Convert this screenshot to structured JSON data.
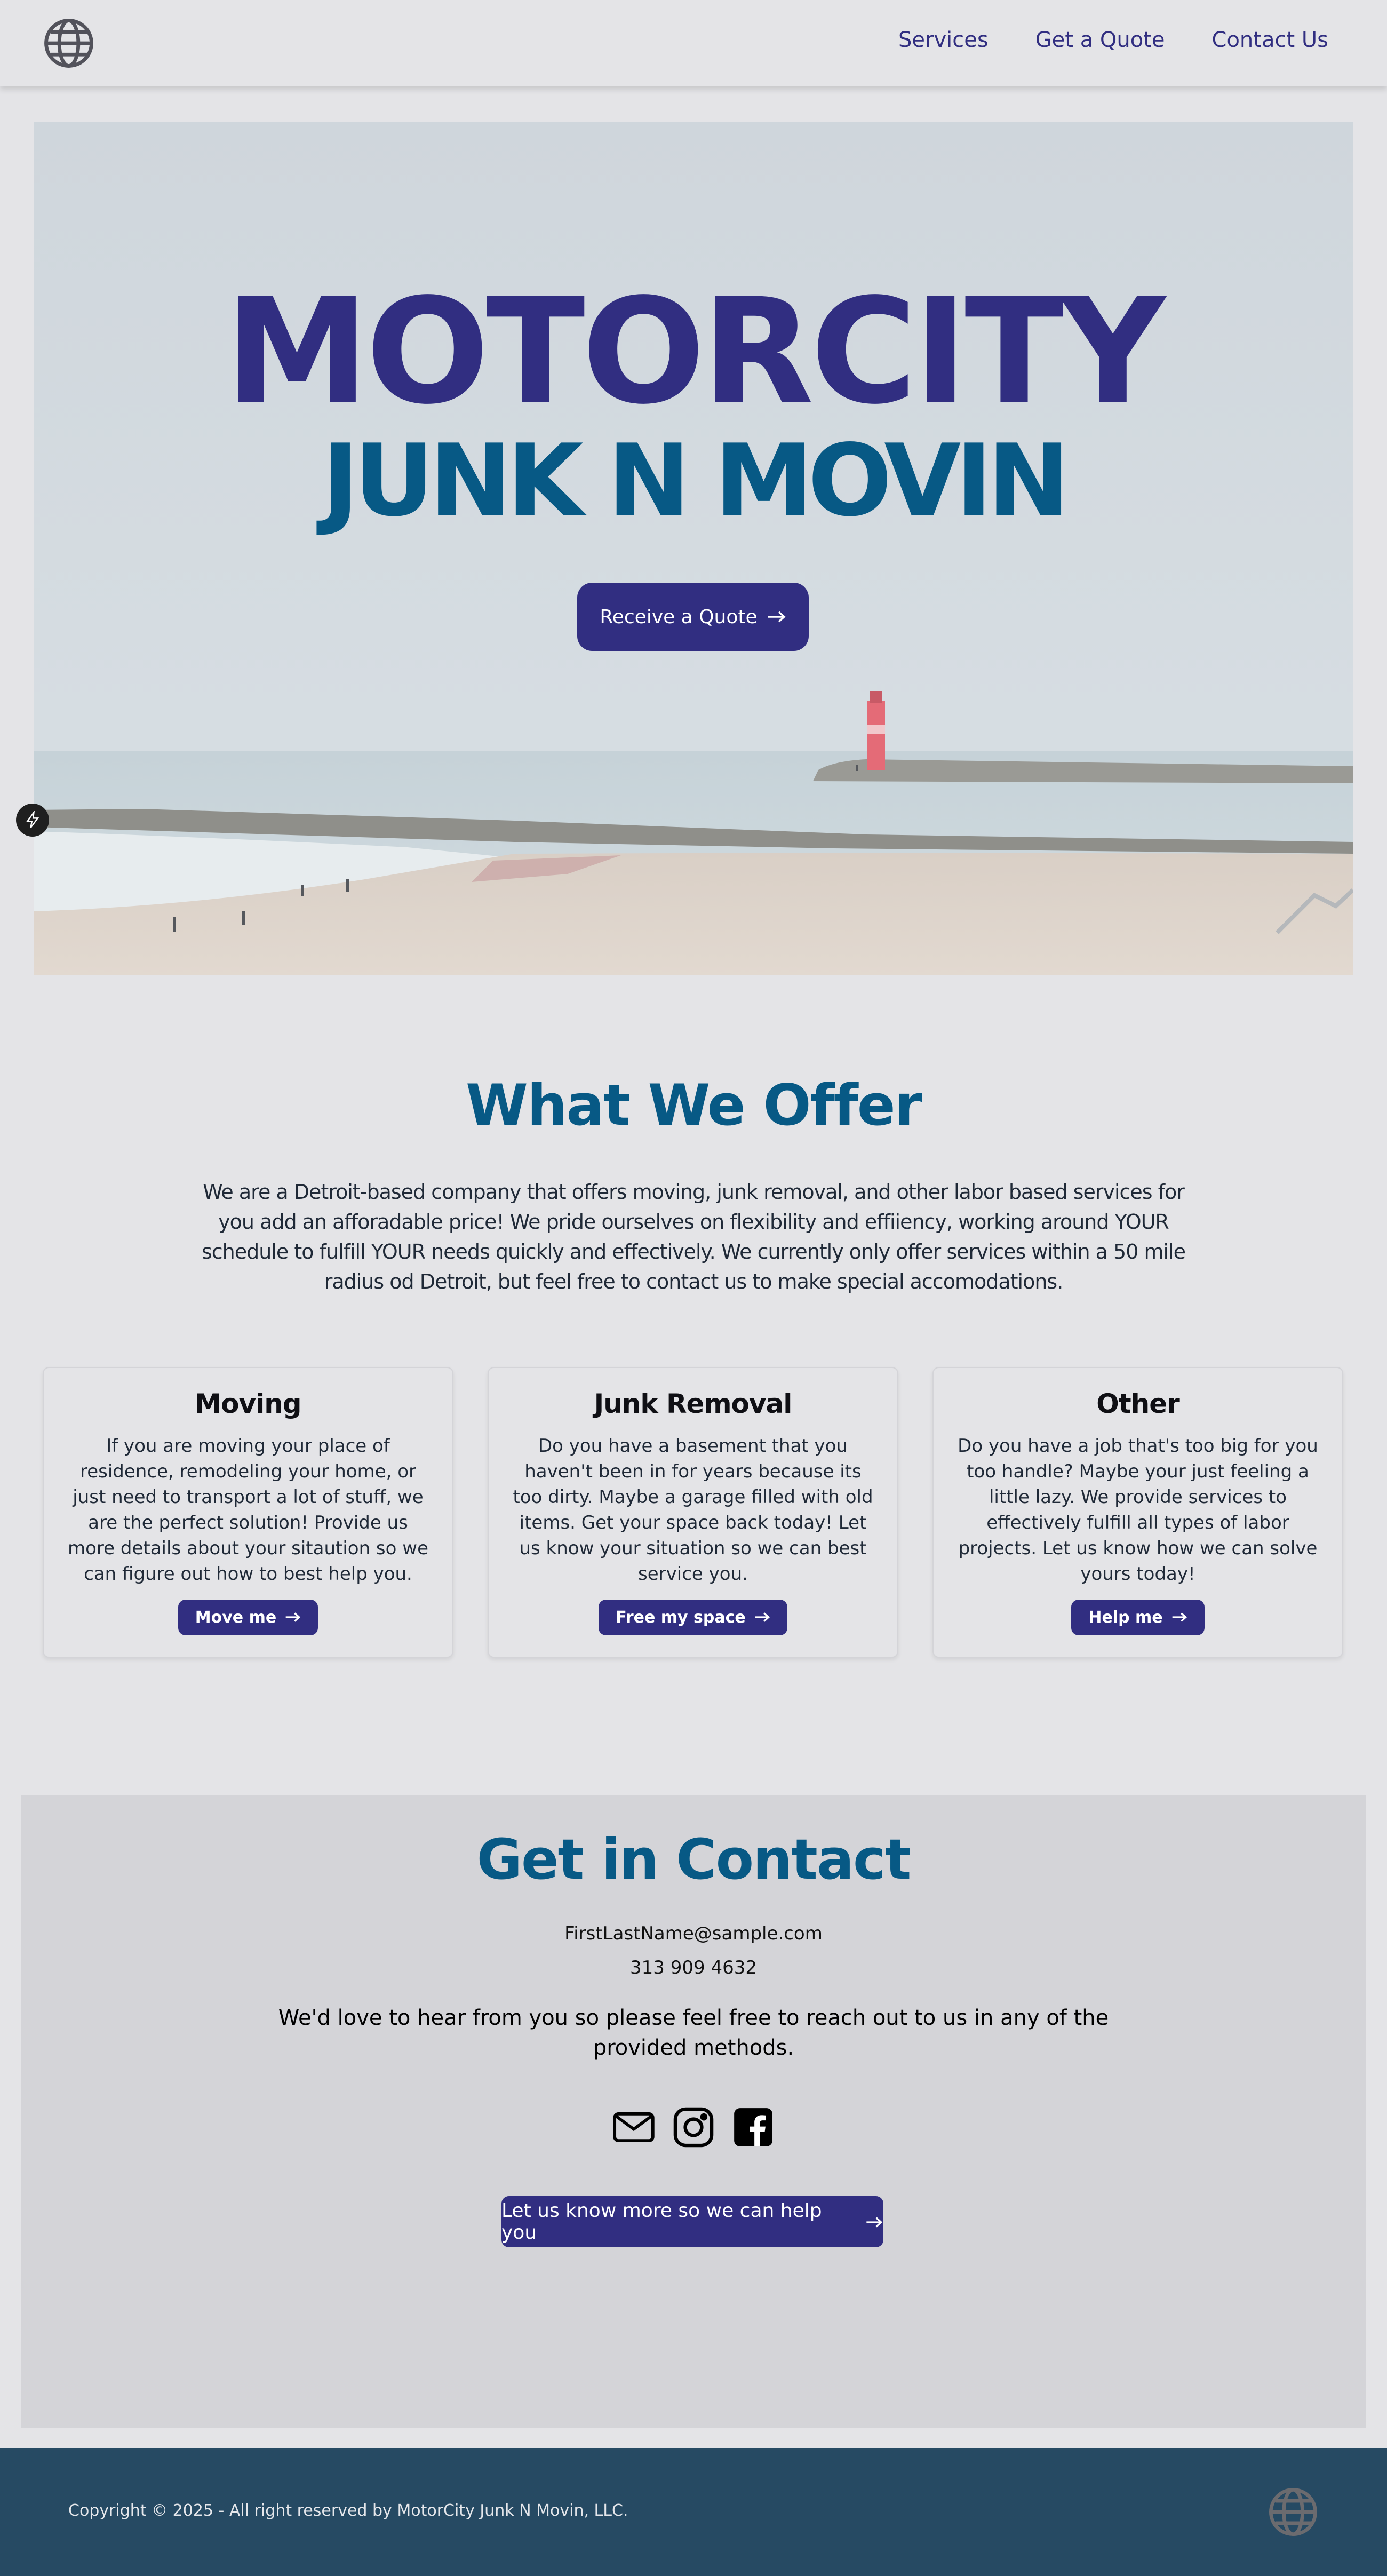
{
  "colors": {
    "brand_indigo": "#312e81",
    "brand_blue": "#075985",
    "page_bg": "#e4e4e7",
    "contact_bg": "#d4d4d8",
    "footer_bg": "#264a63"
  },
  "header": {
    "logo_icon": "globe-icon",
    "nav": [
      {
        "label": "Services"
      },
      {
        "label": "Get a Quote"
      },
      {
        "label": "Contact Us"
      }
    ]
  },
  "hero": {
    "title": "MOTORCITY",
    "subtitle": "JUNK N MOVIN",
    "cta_label": "Receive a Quote",
    "background": "beach-pier-lighthouse-photo"
  },
  "offer": {
    "title": "What We Offer",
    "description": "We are a Detroit-based company that offers moving, junk removal, and other labor based services for you add an afforadable price! We pride ourselves on flexibility and effiiency, working around YOUR schedule to fulfill YOUR needs quickly and effectively. We currently only offer services within a 50 mile radius od Detroit, but feel free to contact us to make special accomodations.",
    "cards": [
      {
        "title": "Moving",
        "text": "If you are moving your place of residence, remodeling your home, or just need to transport a lot of stuff, we are the perfect solution! Provide us more details about your sitaution so we can figure out how to best help you.",
        "button": "Move me"
      },
      {
        "title": "Junk Removal",
        "text": "Do you have a basement that you haven't been in for years because its too dirty. Maybe a garage filled with old items. Get your space back today! Let us know your situation so we can best service you.",
        "button": "Free my space"
      },
      {
        "title": "Other",
        "text": "Do you have a job that's too big for you too handle? Maybe your just feeling a little lazy. We provide services to effectively fulfill all types of labor projects. Let us know how we can solve yours today!",
        "button": "Help me"
      }
    ]
  },
  "contact": {
    "title": "Get in Contact",
    "email": "FirstLastName@sample.com",
    "phone": "313 909 4632",
    "message": "We'd love to hear from you so please feel free to reach out to us in any of the provided methods.",
    "social_icons": [
      "mail-icon",
      "instagram-icon",
      "facebook-icon"
    ],
    "cta_label": "Let us know more so we can help you"
  },
  "footer": {
    "copyright": "Copyright © 2025 - All right reserved by MotorCity Junk N Movin, LLC.",
    "logo_icon": "globe-icon"
  }
}
